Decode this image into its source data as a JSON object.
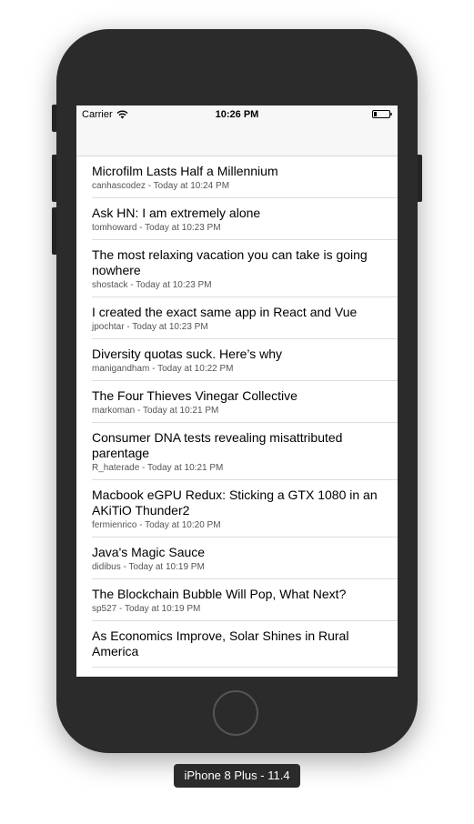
{
  "status_bar": {
    "carrier": "Carrier",
    "time": "10:26 PM",
    "wifi_icon": "wifi-icon",
    "battery_icon": "battery-icon"
  },
  "stories": [
    {
      "title": "Microfilm Lasts Half a Millennium",
      "meta": "canhascodez - Today at 10:24 PM"
    },
    {
      "title": "Ask HN: I am extremely alone",
      "meta": "tomhoward - Today at 10:23 PM"
    },
    {
      "title": "The most relaxing vacation you can take is going nowhere",
      "meta": "shostack - Today at 10:23 PM"
    },
    {
      "title": "I created the exact same app in React and Vue",
      "meta": "jpochtar - Today at 10:23 PM"
    },
    {
      "title": "Diversity quotas suck. Here’s why",
      "meta": "manigandham - Today at 10:22 PM"
    },
    {
      "title": "The Four Thieves Vinegar Collective",
      "meta": "markoman - Today at 10:21 PM"
    },
    {
      "title": "Consumer DNA tests revealing misattributed parentage",
      "meta": "R_haterade - Today at 10:21 PM"
    },
    {
      "title": "Macbook eGPU Redux: Sticking a GTX 1080 in an AKiTiO Thunder2",
      "meta": "fermienrico - Today at 10:20 PM"
    },
    {
      "title": "Java's Magic Sauce",
      "meta": "didibus - Today at 10:19 PM"
    },
    {
      "title": "The Blockchain Bubble Will Pop, What Next?",
      "meta": "sp527 - Today at 10:19 PM"
    },
    {
      "title": "As Economics Improve, Solar Shines in Rural America",
      "meta": ""
    }
  ],
  "device_label": "iPhone 8 Plus - 11.4",
  "home_button_icon": "home-button"
}
